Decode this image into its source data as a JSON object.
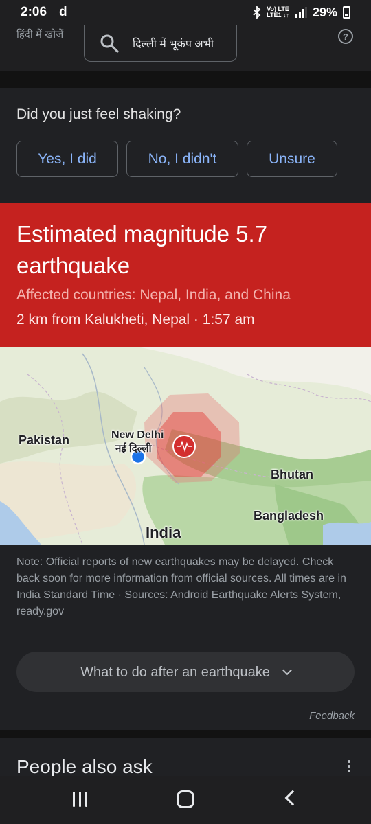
{
  "status_bar": {
    "time": "2:06",
    "app_glyph": "d",
    "network_top": "Vo) LTE",
    "network_bottom": "LTE1 ↓↑",
    "battery": "29%"
  },
  "search": {
    "lang_link": "हिंदी में खोजें",
    "query": "दिल्ली में भूकंप अभी",
    "help_glyph": "?"
  },
  "feel": {
    "question": "Did you just feel shaking?",
    "buttons": [
      "Yes, I did",
      "No, I didn't",
      "Unsure"
    ]
  },
  "alert": {
    "title": "Estimated magnitude 5.7 earthquake",
    "affected": "Affected countries: Nepal, India, and China",
    "location": "2 km from Kalukheti, Nepal · 1:57 am",
    "color": "#c5221f"
  },
  "map": {
    "labels": {
      "pakistan": "Pakistan",
      "new_delhi": "New Delhi",
      "new_delhi_hi": "नई दिल्ली",
      "bhutan": "Bhutan",
      "bangladesh": "Bangladesh",
      "india": "India"
    }
  },
  "note": {
    "text": "Note: Official reports of new earthquakes may be delayed. Check back soon for more information from official sources. All times are in India Standard Time · Sources: ",
    "link": "Android Earthquake Alerts System",
    "suffix": ", ready.gov"
  },
  "expander": {
    "label": "What to do after an earthquake"
  },
  "feedback": "Feedback",
  "people_also_ask": "People also ask"
}
